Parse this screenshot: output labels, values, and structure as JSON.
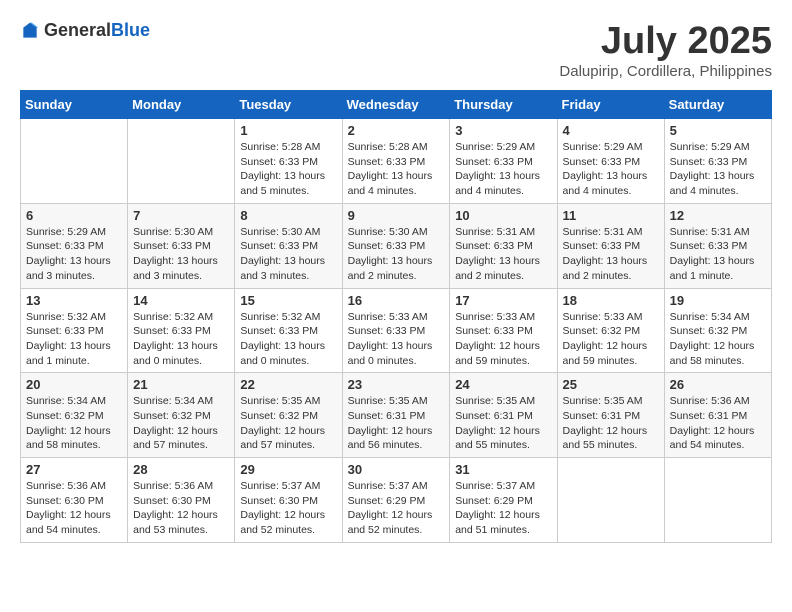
{
  "header": {
    "logo_general": "General",
    "logo_blue": "Blue",
    "month": "July 2025",
    "location": "Dalupirip, Cordillera, Philippines"
  },
  "weekdays": [
    "Sunday",
    "Monday",
    "Tuesday",
    "Wednesday",
    "Thursday",
    "Friday",
    "Saturday"
  ],
  "weeks": [
    [
      {
        "day": "",
        "info": ""
      },
      {
        "day": "",
        "info": ""
      },
      {
        "day": "1",
        "info": "Sunrise: 5:28 AM\nSunset: 6:33 PM\nDaylight: 13 hours and 5 minutes."
      },
      {
        "day": "2",
        "info": "Sunrise: 5:28 AM\nSunset: 6:33 PM\nDaylight: 13 hours and 4 minutes."
      },
      {
        "day": "3",
        "info": "Sunrise: 5:29 AM\nSunset: 6:33 PM\nDaylight: 13 hours and 4 minutes."
      },
      {
        "day": "4",
        "info": "Sunrise: 5:29 AM\nSunset: 6:33 PM\nDaylight: 13 hours and 4 minutes."
      },
      {
        "day": "5",
        "info": "Sunrise: 5:29 AM\nSunset: 6:33 PM\nDaylight: 13 hours and 4 minutes."
      }
    ],
    [
      {
        "day": "6",
        "info": "Sunrise: 5:29 AM\nSunset: 6:33 PM\nDaylight: 13 hours and 3 minutes."
      },
      {
        "day": "7",
        "info": "Sunrise: 5:30 AM\nSunset: 6:33 PM\nDaylight: 13 hours and 3 minutes."
      },
      {
        "day": "8",
        "info": "Sunrise: 5:30 AM\nSunset: 6:33 PM\nDaylight: 13 hours and 3 minutes."
      },
      {
        "day": "9",
        "info": "Sunrise: 5:30 AM\nSunset: 6:33 PM\nDaylight: 13 hours and 2 minutes."
      },
      {
        "day": "10",
        "info": "Sunrise: 5:31 AM\nSunset: 6:33 PM\nDaylight: 13 hours and 2 minutes."
      },
      {
        "day": "11",
        "info": "Sunrise: 5:31 AM\nSunset: 6:33 PM\nDaylight: 13 hours and 2 minutes."
      },
      {
        "day": "12",
        "info": "Sunrise: 5:31 AM\nSunset: 6:33 PM\nDaylight: 13 hours and 1 minute."
      }
    ],
    [
      {
        "day": "13",
        "info": "Sunrise: 5:32 AM\nSunset: 6:33 PM\nDaylight: 13 hours and 1 minute."
      },
      {
        "day": "14",
        "info": "Sunrise: 5:32 AM\nSunset: 6:33 PM\nDaylight: 13 hours and 0 minutes."
      },
      {
        "day": "15",
        "info": "Sunrise: 5:32 AM\nSunset: 6:33 PM\nDaylight: 13 hours and 0 minutes."
      },
      {
        "day": "16",
        "info": "Sunrise: 5:33 AM\nSunset: 6:33 PM\nDaylight: 13 hours and 0 minutes."
      },
      {
        "day": "17",
        "info": "Sunrise: 5:33 AM\nSunset: 6:33 PM\nDaylight: 12 hours and 59 minutes."
      },
      {
        "day": "18",
        "info": "Sunrise: 5:33 AM\nSunset: 6:32 PM\nDaylight: 12 hours and 59 minutes."
      },
      {
        "day": "19",
        "info": "Sunrise: 5:34 AM\nSunset: 6:32 PM\nDaylight: 12 hours and 58 minutes."
      }
    ],
    [
      {
        "day": "20",
        "info": "Sunrise: 5:34 AM\nSunset: 6:32 PM\nDaylight: 12 hours and 58 minutes."
      },
      {
        "day": "21",
        "info": "Sunrise: 5:34 AM\nSunset: 6:32 PM\nDaylight: 12 hours and 57 minutes."
      },
      {
        "day": "22",
        "info": "Sunrise: 5:35 AM\nSunset: 6:32 PM\nDaylight: 12 hours and 57 minutes."
      },
      {
        "day": "23",
        "info": "Sunrise: 5:35 AM\nSunset: 6:31 PM\nDaylight: 12 hours and 56 minutes."
      },
      {
        "day": "24",
        "info": "Sunrise: 5:35 AM\nSunset: 6:31 PM\nDaylight: 12 hours and 55 minutes."
      },
      {
        "day": "25",
        "info": "Sunrise: 5:35 AM\nSunset: 6:31 PM\nDaylight: 12 hours and 55 minutes."
      },
      {
        "day": "26",
        "info": "Sunrise: 5:36 AM\nSunset: 6:31 PM\nDaylight: 12 hours and 54 minutes."
      }
    ],
    [
      {
        "day": "27",
        "info": "Sunrise: 5:36 AM\nSunset: 6:30 PM\nDaylight: 12 hours and 54 minutes."
      },
      {
        "day": "28",
        "info": "Sunrise: 5:36 AM\nSunset: 6:30 PM\nDaylight: 12 hours and 53 minutes."
      },
      {
        "day": "29",
        "info": "Sunrise: 5:37 AM\nSunset: 6:30 PM\nDaylight: 12 hours and 52 minutes."
      },
      {
        "day": "30",
        "info": "Sunrise: 5:37 AM\nSunset: 6:29 PM\nDaylight: 12 hours and 52 minutes."
      },
      {
        "day": "31",
        "info": "Sunrise: 5:37 AM\nSunset: 6:29 PM\nDaylight: 12 hours and 51 minutes."
      },
      {
        "day": "",
        "info": ""
      },
      {
        "day": "",
        "info": ""
      }
    ]
  ]
}
